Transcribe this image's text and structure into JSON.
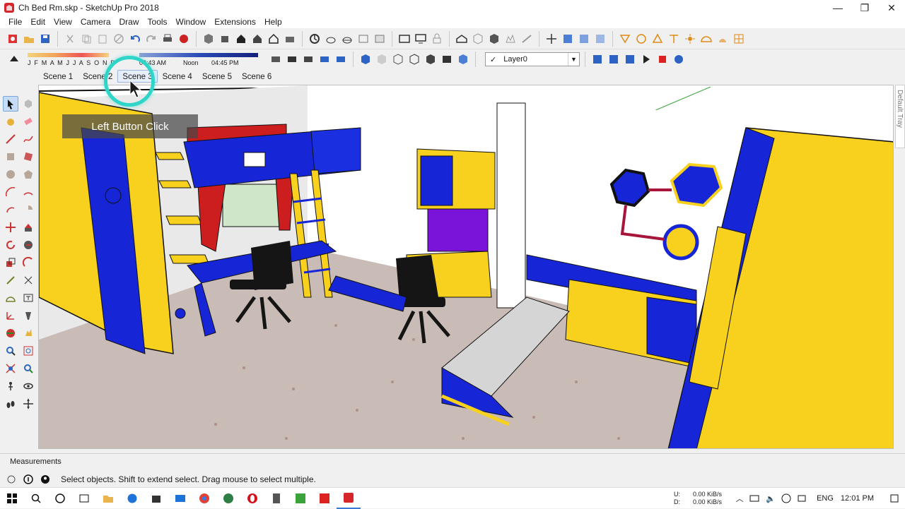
{
  "window": {
    "title": "Ch Bed Rm.skp - SketchUp Pro 2018",
    "minimize": "—",
    "maximize": "❐",
    "close": "✕"
  },
  "menu": [
    "File",
    "Edit",
    "View",
    "Camera",
    "Draw",
    "Tools",
    "Window",
    "Extensions",
    "Help"
  ],
  "shadows": {
    "months": "J F M A M J J A S O N D",
    "time_start": "06:43 AM",
    "time_mid": "Noon",
    "time_end": "04:45 PM"
  },
  "layer": {
    "check": "✓",
    "name": "Layer0"
  },
  "scenes": [
    "Scene 1",
    "Scene 2",
    "Scene 3",
    "Scene 4",
    "Scene 5",
    "Scene 6"
  ],
  "active_scene": "Scene 3",
  "tooltip": "Left Button Click",
  "right_tray": "Default Tray",
  "measurements_label": "Measurements",
  "status_message": "Select objects. Shift to extend select. Drag mouse to select multiple.",
  "taskbar": {
    "net_up": "0.00 KiB/s",
    "net_down": "0.00 KiB/s",
    "net_up_label": "U:",
    "net_down_label": "D:",
    "language": "ENG",
    "clock": "12:01 PM"
  },
  "colors": {
    "yellow": "#f7d11d",
    "blue": "#1626d6",
    "purple": "#7a14d9",
    "floor": "#c6b8b2",
    "red_curtain": "#cc1e1e",
    "accent_ring": "#2fd5c8"
  }
}
